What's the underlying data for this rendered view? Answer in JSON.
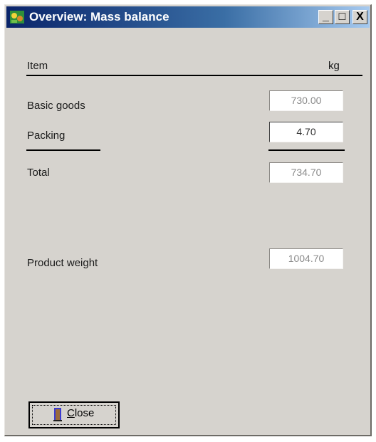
{
  "window": {
    "title": "Overview: Mass balance",
    "controls": {
      "minimize": "_",
      "maximize": "□",
      "close": "X"
    }
  },
  "header": {
    "item_label": "Item",
    "unit_label": "kg"
  },
  "rows": [
    {
      "label": "Basic goods",
      "value": "730.00"
    },
    {
      "label": "Packing",
      "value": "4.70"
    }
  ],
  "total": {
    "label": "Total",
    "value": "734.70"
  },
  "product_weight": {
    "label": "Product weight",
    "value": "1004.70"
  },
  "close_button": {
    "accel": "C",
    "rest": "lose"
  }
}
